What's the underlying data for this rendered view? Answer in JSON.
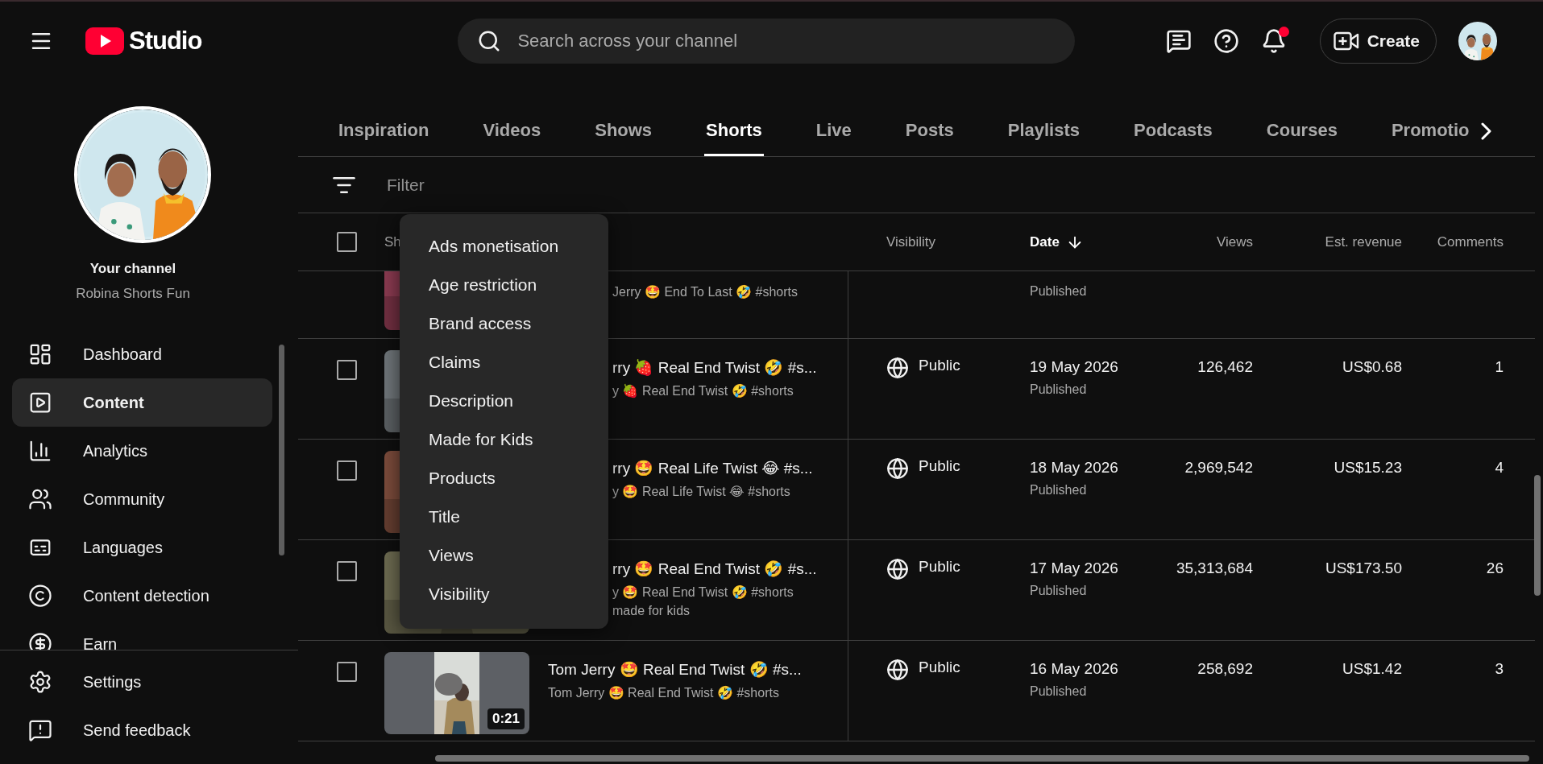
{
  "header": {
    "logo": "Studio",
    "search": {
      "placeholder": "Search across your channel"
    },
    "notifications_unread": true,
    "create_button": "Create"
  },
  "sidebar": {
    "channel_title": "Your channel",
    "channel_name": "Robina Shorts Fun",
    "items": [
      {
        "label": "Dashboard",
        "selected": false
      },
      {
        "label": "Content",
        "selected": true
      },
      {
        "label": "Analytics",
        "selected": false
      },
      {
        "label": "Community",
        "selected": false
      },
      {
        "label": "Languages",
        "selected": false
      },
      {
        "label": "Content detection",
        "selected": false
      },
      {
        "label": "Earn",
        "selected": false
      }
    ],
    "footer_items": [
      "Settings",
      "Send feedback"
    ]
  },
  "tabs": [
    {
      "label": "Inspiration",
      "selected": false
    },
    {
      "label": "Videos",
      "selected": false
    },
    {
      "label": "Shows",
      "selected": false
    },
    {
      "label": "Shorts",
      "selected": true
    },
    {
      "label": "Live",
      "selected": false
    },
    {
      "label": "Posts",
      "selected": false
    },
    {
      "label": "Playlists",
      "selected": false
    },
    {
      "label": "Podcasts",
      "selected": false
    },
    {
      "label": "Courses",
      "selected": false
    },
    {
      "label": "Promotio",
      "selected": false
    }
  ],
  "filter": {
    "placeholder": "Filter"
  },
  "filter_menu": [
    "Ads monetisation",
    "Age restriction",
    "Brand access",
    "Claims",
    "Description",
    "Made for Kids",
    "Products",
    "Title",
    "Views",
    "Visibility"
  ],
  "table": {
    "select_all_checked": false,
    "columns": [
      {
        "label": "Sh",
        "sorted": false
      },
      {
        "label": "Visibility",
        "sorted": false
      },
      {
        "label": "Date",
        "sorted": true
      },
      {
        "label": "Views",
        "sorted": false
      },
      {
        "label": "Est. revenue",
        "sorted": false
      },
      {
        "label": "Comments",
        "sorted": false
      }
    ],
    "rows": [
      {
        "kind": "scrolled",
        "subtitle": "Jerry 🤩 End To Last 🤣 #shorts",
        "status": "Published"
      },
      {
        "kind": "covered",
        "checked": false,
        "title": "rry 🍓 Real End Twist 🤣 #s...",
        "subtitle": "y 🍓 Real End Twist 🤣 #shorts",
        "visibility": "Public",
        "date": "19 May 2026",
        "status": "Published",
        "views": "126,462",
        "revenue": "US$0.68",
        "comments": "1"
      },
      {
        "kind": "covered",
        "checked": false,
        "title": "rry 🤩 Real Life Twist 😂 #s...",
        "subtitle": "y 🤩 Real Life Twist 😂 #shorts",
        "visibility": "Public",
        "date": "18 May 2026",
        "status": "Published",
        "views": "2,969,542",
        "revenue": "US$15.23",
        "comments": "4"
      },
      {
        "kind": "covered",
        "checked": false,
        "title": "rry 🤩 Real End Twist 🤣 #s...",
        "subtitle": "y 🤩 Real End Twist 🤣 #shorts",
        "note": "made for kids",
        "visibility": "Public",
        "date": "17 May 2026",
        "status": "Published",
        "views": "35,313,684",
        "revenue": "US$173.50",
        "comments": "26"
      },
      {
        "kind": "full",
        "checked": false,
        "title": "Tom Jerry 🤩 Real End Twist 🤣 #s...",
        "subtitle": "Tom Jerry 🤩 Real End Twist 🤣 #shorts",
        "duration": "0:21",
        "visibility": "Public",
        "date": "16 May 2026",
        "status": "Published",
        "views": "258,692",
        "revenue": "US$1.42",
        "comments": "3"
      }
    ]
  }
}
